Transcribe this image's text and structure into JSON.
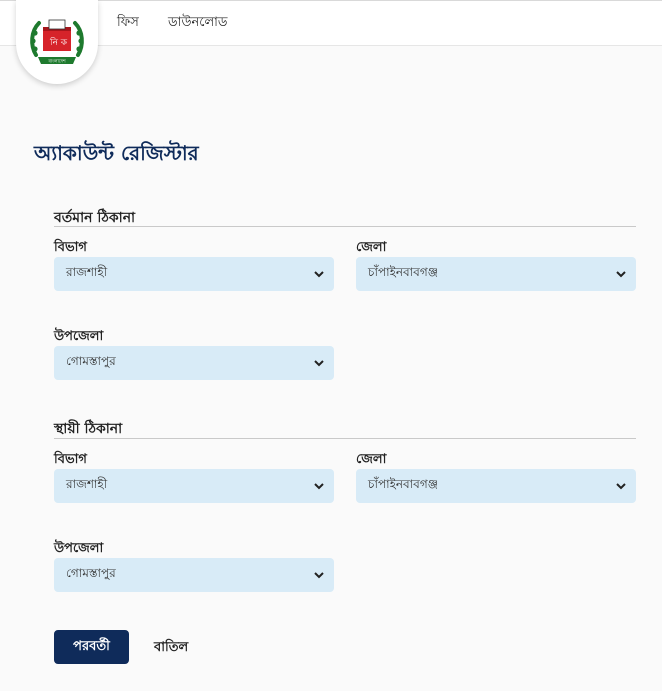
{
  "nav": {
    "logo_text": "নি ক",
    "logo_caption": "বাংলাদেশ",
    "links": [
      "ফিস",
      "ডাউনলোড"
    ]
  },
  "page_title": "অ্যাকাউন্ট রেজিস্টার",
  "present_address": {
    "title": "বর্তমান ঠিকানা",
    "division_label": "বিভাগ",
    "division_value": "রাজশাহী",
    "district_label": "জেলা",
    "district_value": "চাঁপাইনবাবগঞ্জ",
    "upazila_label": "উপজেলা",
    "upazila_value": "গোমস্তাপুর"
  },
  "permanent_address": {
    "title": "স্থায়ী ঠিকানা",
    "division_label": "বিভাগ",
    "division_value": "রাজশাহী",
    "district_label": "জেলা",
    "district_value": "চাঁপাইনবাবগঞ্জ",
    "upazila_label": "উপজেলা",
    "upazila_value": "গোমস্তাপুর"
  },
  "actions": {
    "next_label": "পরবর্তী",
    "cancel_label": "বাতিল"
  },
  "colors": {
    "primary": "#0f2b5a",
    "select_bg": "#d8ebf7",
    "logo_green": "#1e7a2e",
    "logo_red": "#d6232a"
  }
}
